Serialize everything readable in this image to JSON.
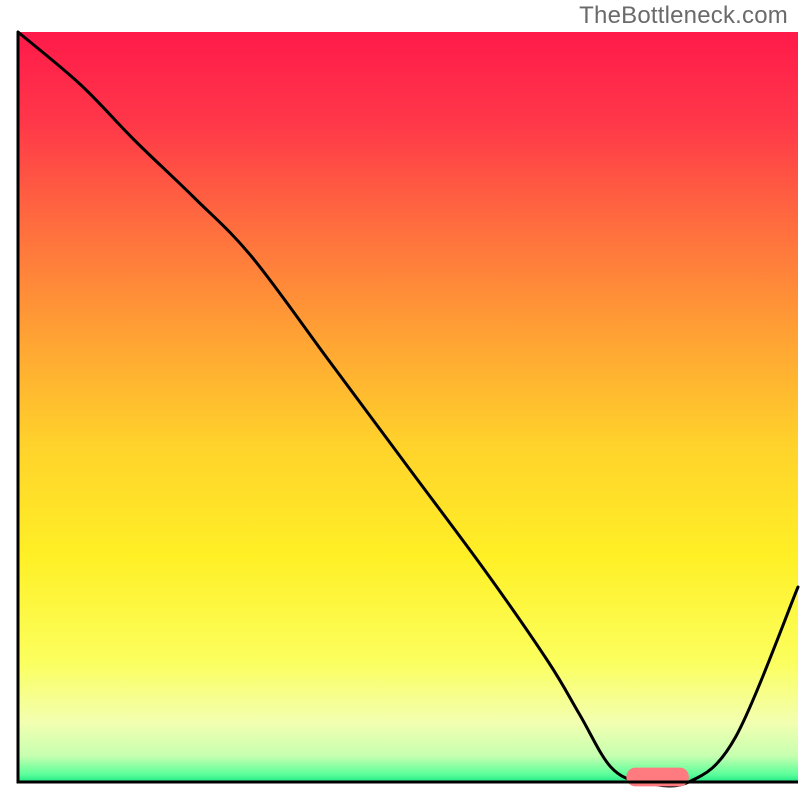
{
  "watermark": "TheBottleneck.com",
  "chart_data": {
    "type": "line",
    "title": "",
    "xlabel": "",
    "ylabel": "",
    "xlim": [
      0,
      100
    ],
    "ylim": [
      0,
      100
    ],
    "grid": false,
    "legend": false,
    "gradient_stops": [
      {
        "offset": 0,
        "color": "#ff1a4a"
      },
      {
        "offset": 0.12,
        "color": "#ff3749"
      },
      {
        "offset": 0.25,
        "color": "#ff6a3f"
      },
      {
        "offset": 0.4,
        "color": "#ffa034"
      },
      {
        "offset": 0.55,
        "color": "#ffd22b"
      },
      {
        "offset": 0.7,
        "color": "#fff026"
      },
      {
        "offset": 0.84,
        "color": "#fbff5e"
      },
      {
        "offset": 0.92,
        "color": "#f3ffb0"
      },
      {
        "offset": 0.965,
        "color": "#c7ffb0"
      },
      {
        "offset": 0.99,
        "color": "#5bff9a"
      },
      {
        "offset": 1.0,
        "color": "#21e686"
      }
    ],
    "series": [
      {
        "name": "bottleneck-curve",
        "color": "#000000",
        "stroke_width": 3,
        "x": [
          0,
          8,
          15,
          22.5,
          30,
          40,
          50,
          60,
          68,
          72,
          76,
          80,
          86,
          92,
          100
        ],
        "y": [
          100,
          93,
          85.5,
          78,
          70,
          56,
          42,
          28,
          16,
          9,
          2,
          0,
          0,
          6,
          26
        ]
      }
    ],
    "marker": {
      "name": "optimum-marker",
      "color": "#ff7b80",
      "x_start": 78,
      "x_end": 86,
      "y": 0,
      "thickness": 2.5
    },
    "axes": {
      "color": "#000000",
      "width": 3
    }
  }
}
